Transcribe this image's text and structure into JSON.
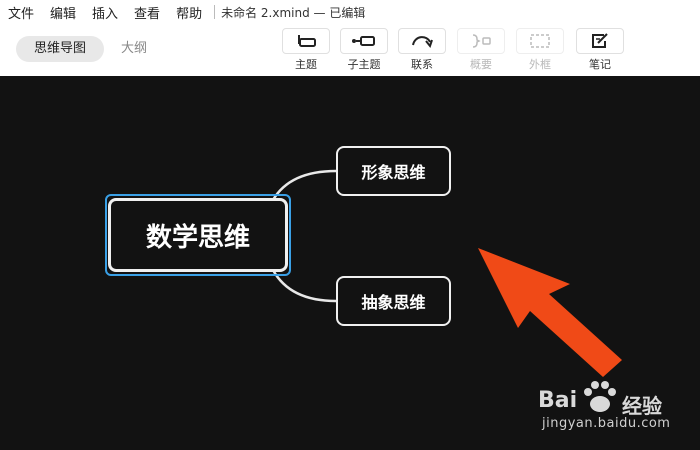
{
  "menu": {
    "items": [
      "文件",
      "编辑",
      "插入",
      "查看",
      "帮助"
    ],
    "doc_title": "未命名 2.xmind — 已编辑"
  },
  "view_tabs": {
    "mindmap": "思维导图",
    "outline": "大纲"
  },
  "toolbar": {
    "topic": "主题",
    "subtopic": "子主题",
    "relationship": "联系",
    "summary": "概要",
    "boundary": "外框",
    "note": "笔记"
  },
  "map": {
    "central": "数学思维",
    "subtopics": [
      "形象思维",
      "抽象思维"
    ]
  },
  "watermark": {
    "brand_left": "Bai",
    "brand_right": "经验",
    "url": "jingyan.baidu.com"
  },
  "colors": {
    "canvas": "#121212",
    "selection": "#3aa0e6",
    "arrow": "#f04a17"
  }
}
